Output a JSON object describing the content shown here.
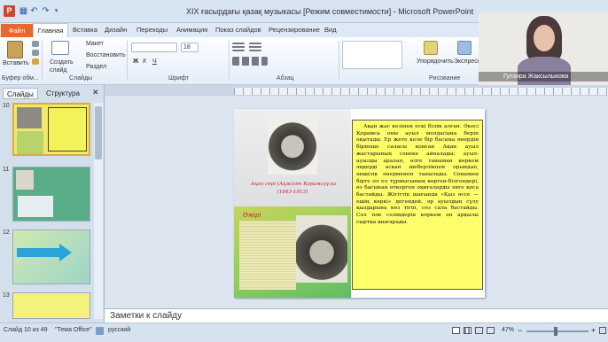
{
  "window": {
    "title": "XIX ғасырдағы қазақ музыкасы [Режим совместимости] - Microsoft PowerPoint"
  },
  "ribbon": {
    "tabs": [
      {
        "label": "Файл"
      },
      {
        "label": "Главная"
      },
      {
        "label": "Вставка"
      },
      {
        "label": "Дизайн"
      },
      {
        "label": "Переходы"
      },
      {
        "label": "Анимация"
      },
      {
        "label": "Показ слайдов"
      },
      {
        "label": "Рецензирование"
      },
      {
        "label": "Вид"
      }
    ],
    "paste_label": "Вставить",
    "clipboard_group": "Буфер обм...",
    "new_slide_label": "Создать слайд",
    "layout_label": "Макет",
    "reset_label": "Восстановить",
    "section_label": "Раздел",
    "slides_group": "Слайды",
    "font_size": "18",
    "font_group": "Шрифт",
    "paragraph_group": "Абзац",
    "arrange_label": "Упорядочить",
    "express_label": "Экспресс",
    "drawing_group": "Рисование"
  },
  "video": {
    "name": "Гулзира Жаксылыкова"
  },
  "panel": {
    "tab_slides": "Слайды",
    "tab_outline": "Структура",
    "slides": [
      {
        "number": "10"
      },
      {
        "number": "11"
      },
      {
        "number": "12"
      },
      {
        "number": "13"
      }
    ]
  },
  "slide": {
    "caption_name": "Ақан серi (Aқжiгiт Қорамсаұлы",
    "caption_years": "(1843-1913)",
    "section_title": "Өмiрi",
    "main_text": "Ақан жас кезінен ескі білім алған. Әкесі Қорамса оны ауыл молдасына беріп оқытады. Ер жете келе бір басына өнердің бірнеше саласы қонған Ақан ауыл жастарының сәнеке айналады; ауыл-ауылды аралап, өлге таныман көркем әңдерді асқан шеберлікпен орындап, әншілік өнерменен танылады. Сонымен бірге ол ел тұрмысының көрген-білгендері, өз басынан өткерген оқиғаларды әнге қоса бастайды. Жігіттік шағында «Қыз өссе — ешің көркі» дегендей, әр ауылдың сұлу қыздарына көз тігіп, сөз сала бастайды. Сол пәк сезімдерін көркем ән арқылы сыртқа шығарады."
  },
  "notes": {
    "placeholder": "Заметки к слайду"
  },
  "status": {
    "slide_counter": "Слайд 10 из 49",
    "theme": "\"Тема Office\"",
    "language": "русский",
    "zoom": "47%"
  }
}
